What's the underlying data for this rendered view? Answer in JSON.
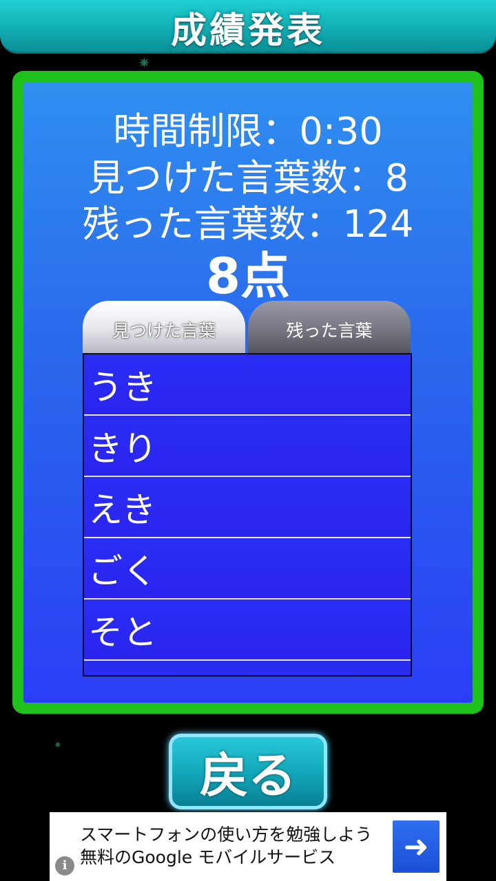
{
  "header": {
    "title": "成績発表"
  },
  "stats": {
    "time_limit": "時間制限：0:30",
    "found_words": "見つけた言葉数：8",
    "remaining_words": "残った言葉数：124"
  },
  "score": "8点",
  "tabs": [
    {
      "label": "見つけた言葉",
      "active": true
    },
    {
      "label": "残った言葉",
      "active": false
    }
  ],
  "words": [
    "うき",
    "きり",
    "えき",
    "ごく",
    "そと"
  ],
  "back_button": {
    "label": "戻る"
  },
  "ad": {
    "text": "スマートフォンの使い方を勉強しよう 無料のGoogle モバイルサービス",
    "info_icon": "i",
    "arrow_icon": "➜"
  },
  "colors": {
    "header": "#13b4b8",
    "panel_border": "#1fc21a",
    "panel_background": "#2a67ec",
    "list_background": "#2a2cf0",
    "button": "#11a5b8"
  }
}
